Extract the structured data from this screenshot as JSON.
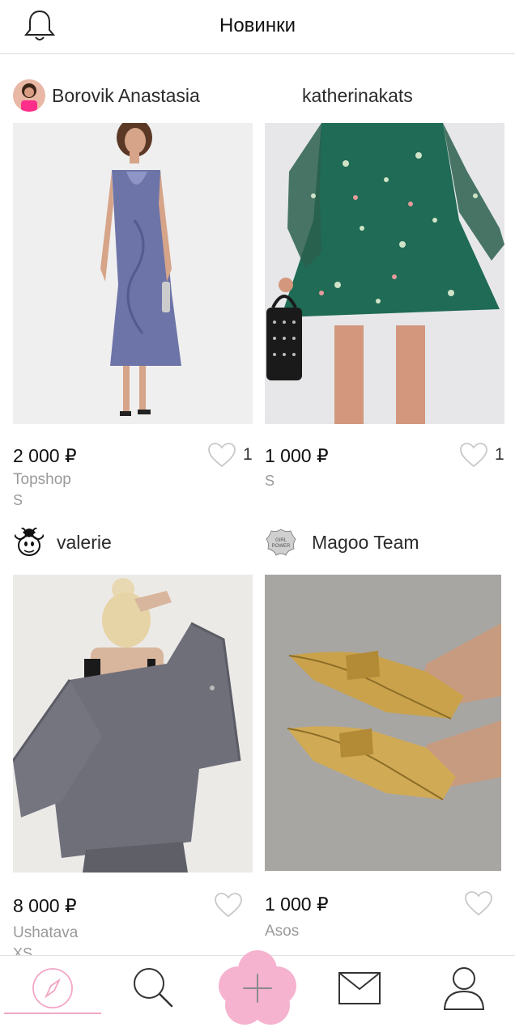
{
  "header": {
    "title": "Новинки",
    "bell_icon": "bell-icon"
  },
  "feed": [
    {
      "user": "Borovik Anastasia",
      "avatar": "avatar-photo",
      "price": "2 000 ₽",
      "brand": "Topshop",
      "size": "S",
      "likes": "1",
      "photo": "satin-slip-dress"
    },
    {
      "user": "katherinakats",
      "avatar": "",
      "price": "1 000 ₽",
      "brand": "",
      "size": "S",
      "likes": "1",
      "photo": "green-floral-dress"
    },
    {
      "user": "valerie",
      "avatar": "mouse-cartoon-avatar",
      "price": "8 000 ₽",
      "brand": "Ushatava",
      "size": "XS",
      "likes": "",
      "photo": "gray-suit-jacket"
    },
    {
      "user": "Magoo Team",
      "avatar": "girl-power-avatar",
      "price": "1 000 ₽",
      "brand": "Asos",
      "size": "",
      "likes": "",
      "photo": "gold-flat-shoes"
    }
  ],
  "tabbar": {
    "items": [
      {
        "name": "discover",
        "icon": "compass-icon",
        "active": true
      },
      {
        "name": "search",
        "icon": "search-icon",
        "active": false
      },
      {
        "name": "add",
        "icon": "plus-icon",
        "active": false
      },
      {
        "name": "messages",
        "icon": "envelope-icon",
        "active": false
      },
      {
        "name": "profile",
        "icon": "user-icon",
        "active": false
      }
    ]
  },
  "colors": {
    "accent": "#f2a6c6",
    "fab": "#f5b3d0",
    "muted_text": "#9a9a9a",
    "divider": "#d9d9d9"
  }
}
